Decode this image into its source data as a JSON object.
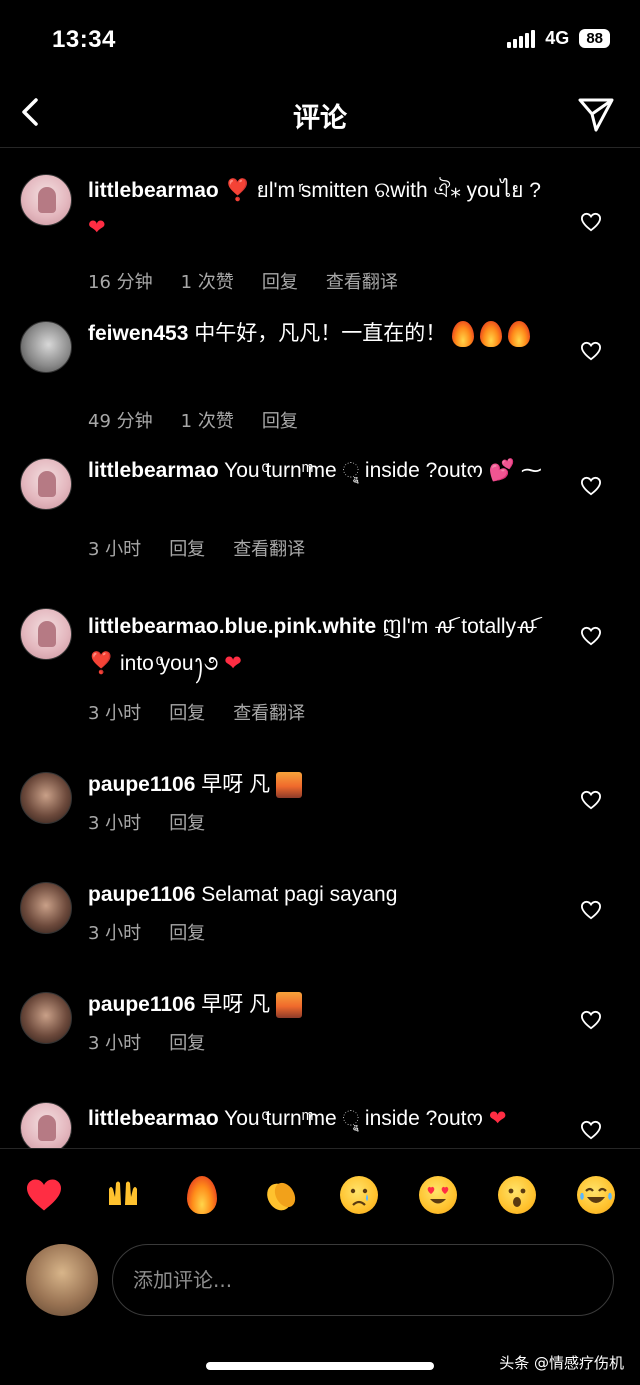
{
  "status": {
    "time": "13:34",
    "network": "4G",
    "battery": "88"
  },
  "header": {
    "title": "评论"
  },
  "comments": [
    {
      "user": "littlebearmao",
      "text": " ❣️ ยl'm ͬsmitten ରwith ঐ⁎ youไย ?",
      "meta": [
        "16 分钟",
        "1 次赞",
        "回复",
        "查看翻译"
      ]
    },
    {
      "user": "feiwen453",
      "text": " 中午好，凡凡！一直在的！",
      "meta": [
        "49 分钟",
        "1 次赞",
        "回复"
      ]
    },
    {
      "user": "littlebearmao",
      "text": " You ͦturn ͫme ୣ inside ?outო",
      "meta": [
        "3 小时",
        "回复",
        "查看翻译"
      ]
    },
    {
      "user": "littlebearmao.blue.pink.white",
      "text": " ញl'm ꫛ totallyꫛ ❣️ into ͦyouꫂ૭",
      "meta": [
        "3 小时",
        "回复",
        "查看翻译"
      ]
    },
    {
      "user": "paupe1106",
      "text": " 早呀 凡",
      "meta": [
        "3 小时",
        "回复"
      ]
    },
    {
      "user": "paupe1106",
      "text": " Selamat pagi sayang",
      "meta": [
        "3 小时",
        "回复"
      ]
    },
    {
      "user": "paupe1106",
      "text": " 早呀 凡",
      "meta": [
        "3 小时",
        "回复"
      ]
    },
    {
      "user": "littlebearmao",
      "text": " You ͦturn ͫme ୣ inside ?outო",
      "meta": []
    }
  ],
  "reactions": [
    "heart",
    "raised-hands",
    "fire",
    "clapping-hands",
    "crying-face",
    "heart-eyes-face",
    "surprised-face",
    "tears-of-joy-face"
  ],
  "composer": {
    "placeholder": "添加评论..."
  },
  "watermark": "头条 @情感疗伤机",
  "colors": {
    "background": "#000000",
    "meta": "#a8a8a8",
    "heart_red": "#ff2d43"
  }
}
